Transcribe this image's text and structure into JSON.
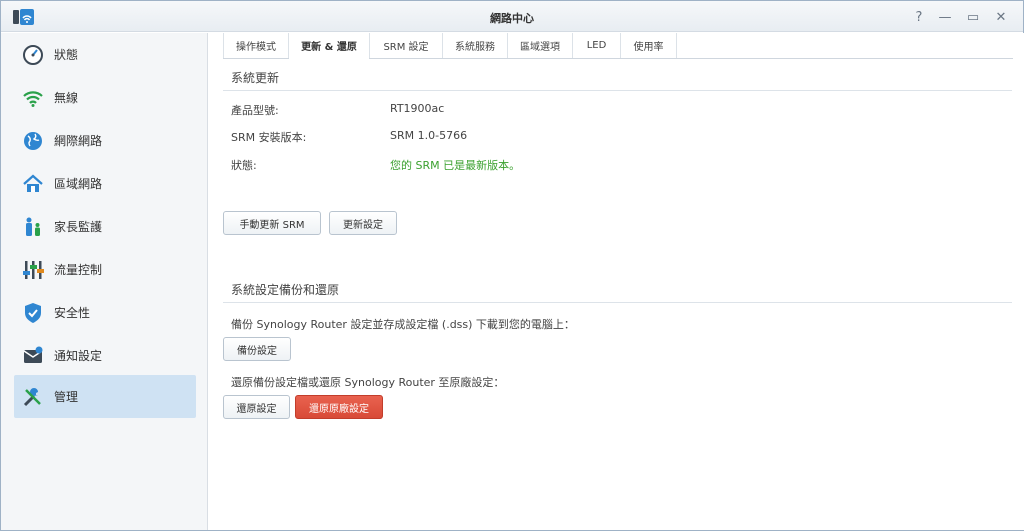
{
  "window": {
    "title": "網路中心",
    "controls": {
      "help": "?",
      "minimize": "—",
      "maximize": "▭",
      "close": "✕"
    }
  },
  "sidebar": {
    "items": [
      {
        "label": "狀態",
        "icon": "gauge-icon"
      },
      {
        "label": "無線",
        "icon": "wifi-icon"
      },
      {
        "label": "網際網路",
        "icon": "globe-icon"
      },
      {
        "label": "區域網路",
        "icon": "home-network-icon"
      },
      {
        "label": "家長監護",
        "icon": "family-icon"
      },
      {
        "label": "流量控制",
        "icon": "sliders-icon"
      },
      {
        "label": "安全性",
        "icon": "shield-icon"
      },
      {
        "label": "通知設定",
        "icon": "notification-icon"
      },
      {
        "label": "管理",
        "icon": "tools-icon",
        "active": true
      }
    ]
  },
  "tabs": [
    {
      "label": "操作模式"
    },
    {
      "label": "更新 & 還原",
      "active": true
    },
    {
      "label": "SRM 設定"
    },
    {
      "label": "系統服務"
    },
    {
      "label": "區域選項"
    },
    {
      "label": "LED"
    },
    {
      "label": "使用率"
    }
  ],
  "system_update": {
    "title": "系統更新",
    "model_label": "產品型號:",
    "model_value": "RT1900ac",
    "version_label": "SRM 安裝版本:",
    "version_value": "SRM 1.0-5766",
    "status_label": "狀態:",
    "status_value": "您的 SRM 已是最新版本。",
    "manual_update_button": "手動更新 SRM",
    "update_settings_button": "更新設定"
  },
  "backup_restore": {
    "title": "系統設定備份和還原",
    "backup_desc": "備份 Synology Router 設定並存成設定檔 (.dss) 下載到您的電腦上：",
    "backup_button": "備份設定",
    "restore_desc": "還原備份設定檔或還原 Synology Router 至原廠設定：",
    "restore_button": "還原設定",
    "factory_reset_button": "還原原廠設定"
  },
  "colors": {
    "accent": "#cfe2f3",
    "ok_status": "#3aa02e",
    "danger": "#d84a37"
  }
}
